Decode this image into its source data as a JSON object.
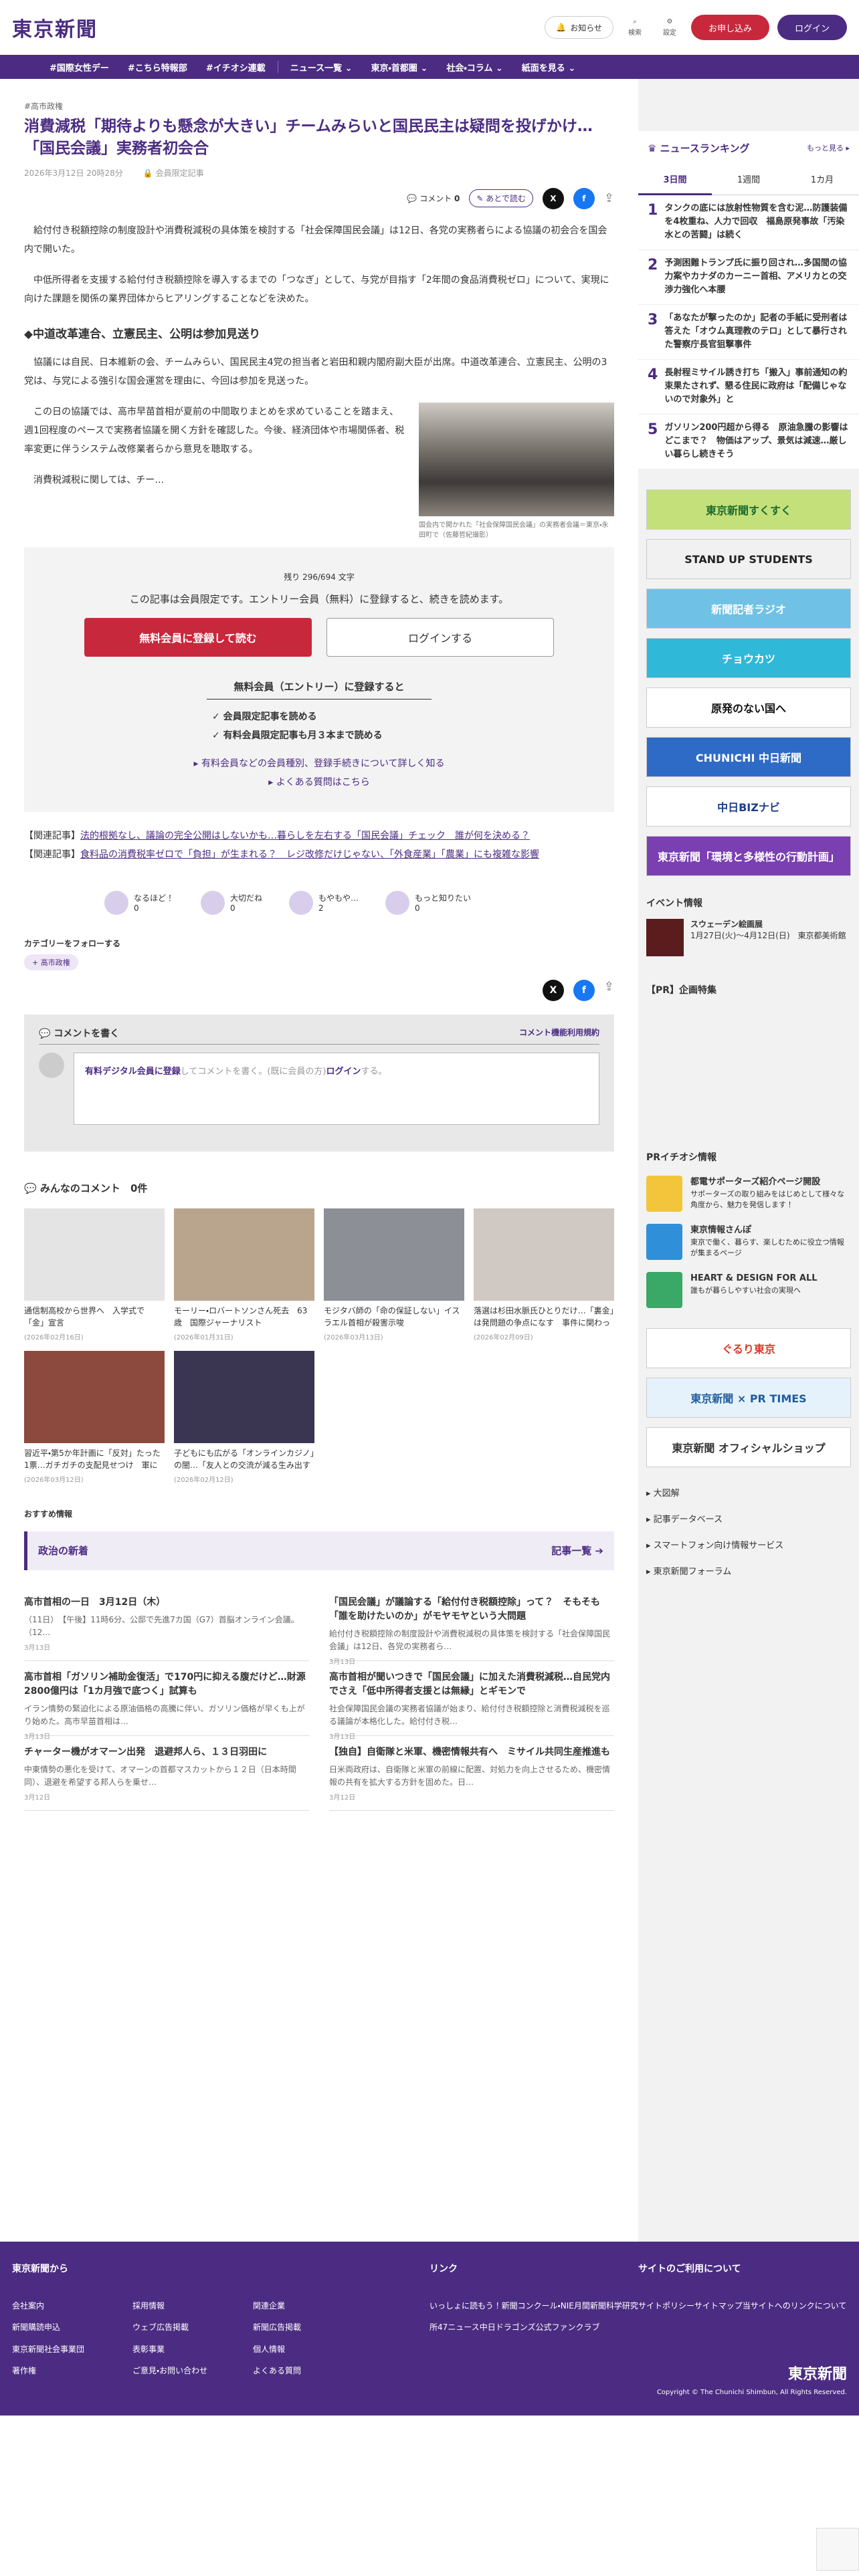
{
  "header": {
    "logo": "東京新聞",
    "notify": "お知らせ",
    "search": "検索",
    "settings": "設定",
    "subscribe": "お申し込み",
    "login": "ログイン"
  },
  "nav": [
    "#国際女性デー",
    "#こちら特報部",
    "#イチオシ連載",
    "ニュース一覧 ⌄",
    "東京・首都圏 ⌄",
    "社会・コラム ⌄",
    "紙面を見る ⌄"
  ],
  "article": {
    "tag": "#高市政権",
    "title": "消費減税「期待よりも懸念が大きい」チームみらいと国民民主は疑問を投げかけ…「国民会議」実務者初会合",
    "date": "2026年3月12日 20時28分",
    "members": "会員限定記事",
    "comments_label": "コメント",
    "comments_count": "0",
    "later": "あとで読む",
    "p1": "給付付き税額控除の制度設計や消費税減税の具体策を検討する「社会保障国民会議」は12日、各党の実務者らによる協議の初会合を国会内で開いた。",
    "p2": "中低所得者を支援する給付付き税額控除を導入するまでの「つなぎ」として、与党が目指す「2年間の食品消費税ゼロ」について、実現に向けた課題を関係の業界団体からヒアリングすることなどを決めた。",
    "h2": "◆中道改革連合、立憲民主、公明は参加見送り",
    "p3": "協議には自民、日本維新の会、チームみらい、国民民主4党の担当者と岩田和親内閣府副大臣が出席。中道改革連合、立憲民主、公明の3党は、与党による強引な国会運営を理由に、今回は参加を見送った。",
    "p4": "この日の協議では、高市早苗首相が夏前の中間取りまとめを求めていることを踏まえ、週1回程度のペースで実務者協議を開く方針を確認した。今後、経済団体や市場関係者、税率変更に伴うシステム改修業者らから意見を聴取する。",
    "p5": "消費税減税に関しては、チー…",
    "caption": "国会内で開かれた「社会保障国民会議」の実務者会議＝東京・永田町で（佐藤哲紀撮影）"
  },
  "paywall": {
    "remaining": "残り 296/694 文字",
    "msg": "この記事は会員限定です。エントリー会員（無料）に登録すると、続きを読めます。",
    "register": "無料会員に登録して読む",
    "login": "ログインする",
    "h3": "無料会員（エントリー）に登録すると",
    "b1": "✓ 会員限定記事を読める",
    "b2": "✓ 有料会員限定記事も月３本まで読める",
    "l1": "▸ 有料会員などの会員種別、登録手続きについて詳しく知る",
    "l2": "▸ よくある質問はこちら"
  },
  "related": [
    {
      "label": "【関連記事】",
      "link": "法的根拠なし、議論の完全公開はしないかも…暮らしを左右する「国民会議」チェック　誰が何を決める？"
    },
    {
      "label": "【関連記事】",
      "link": "食料品の消費税率ゼロで「負担」が生まれる？　レジ改修だけじゃない、「外食産業」「農業」にも複雑な影響"
    }
  ],
  "reactions": [
    {
      "label": "なるほど！",
      "count": "0"
    },
    {
      "label": "大切だね",
      "count": "0"
    },
    {
      "label": "もやもや…",
      "count": "2"
    },
    {
      "label": "もっと知りたい",
      "count": "0"
    }
  ],
  "follow": {
    "title": "カテゴリーをフォローする",
    "tag": "高市政権"
  },
  "comment": {
    "title": "コメントを書く",
    "rules": "コメント機能利用規約",
    "cta_link": "有料デジタル会員に登録",
    "cta_mid": "してコメントを書く。(既に会員の方)",
    "cta_login": "ログイン",
    "cta_end": "する。"
  },
  "everyone": {
    "title": "みんなのコメント",
    "count": "0件"
  },
  "cards": [
    {
      "t": "通信制高校から世界へ　入学式で「金」宣言",
      "d": "(2026年02月16日)",
      "c": "#e4e4e4"
    },
    {
      "t": "モーリー・ロバートソンさん死去　63歳　国際ジャーナリスト",
      "d": "(2026年01月31日)",
      "c": "#b9a58d"
    },
    {
      "t": "モジタバ師の「命の保証しない」イスラエル首相が殺害示唆",
      "d": "(2026年03月13日)",
      "c": "#8d8f96"
    },
    {
      "t": "落選は杉田水脈氏ひとりだけ…「裏金」は発問題の争点になす　事件に関わった公認候補…",
      "d": "(2026年02月09日)",
      "c": "#d0c8c2"
    },
    {
      "t": "習近平・第5か年計画に「反対」たった1票…ガチガチの支配見せつけ　軍にも「絶対服従」「ム…",
      "d": "(2026年03月12日)",
      "c": "#8c4a3e"
    },
    {
      "t": "子どもにも広がる「オンラインカジノ」の闇…「友人との交流が減る生み出す悪循環」専門…",
      "d": "(2026年02月12日)",
      "c": "#3a3550"
    }
  ],
  "osusume": "おすすめ情報",
  "politics": {
    "title": "政治の新着",
    "more": "記事一覧 ➔",
    "items": [
      {
        "t": "高市首相の一日　3月12日（木）",
        "s": "（11日）　【午後】11時6分、公邸で先進7カ国（G7）首脳オンライン会議。（12…",
        "d": "3月13日"
      },
      {
        "t": "「国民会議」が議論する「給付付き税額控除」って？　そもそも「誰を助けたいのか」がモヤモヤという大問題",
        "s": "給付付き税額控除の制度設計や消費税減税の具体策を検討する「社会保障国民会議」は12日、各党の実務者ら…",
        "d": "3月13日"
      },
      {
        "t": "高市首相「ガソリン補助金復活」で170円に抑える腹だけど…財源2800億円は「1カ月強で底つく」試算も",
        "s": "イラン情勢の緊迫化による原油価格の高騰に伴い、ガソリン価格が早くも上がり始めた。高市早苗首相は…",
        "d": "3月13日"
      },
      {
        "t": "高市首相が聞いつきで「国民会議」に加えた消費税減税…自民党内でさえ「低中所得者支援とは無縁」とギモンで",
        "s": "社会保障国民会議の実務者協議が始まり、給付付き税額控除と消費税減税を巡る議論が本格化した。給付付き税…",
        "d": "3月13日"
      },
      {
        "t": "チャーター機がオマーン出発　退避邦人ら、１３日羽田に",
        "s": "中東情勢の悪化を受けて、オマーンの首都マスカットから１２日（日本時間同）、退避を希望する邦人らを乗せ…",
        "d": "3月12日"
      },
      {
        "t": "【独自】自衛隊と米軍、機密情報共有へ　ミサイル共同生産推進も",
        "s": "日米両政府は、自衛隊と米軍の前線に配置、対処力を向上させるため、機密情報の共有を拡大する方針を固めた。日…",
        "d": "3月12日"
      }
    ]
  },
  "ranking": {
    "title": "ニュースランキング",
    "more": "もっと見る ▸",
    "tabs": [
      "3日間",
      "1週間",
      "1カ月"
    ],
    "items": [
      {
        "n": "1",
        "t": "タンクの底には放射性物質を含む泥…防護装備を4枚重ね、人力で回収　福島原発事故「汚染水との苦闘」は続く"
      },
      {
        "n": "2",
        "t": "予測困難トランプ氏に振り回され…多国間の協力案やカナダのカーニー首相、アメリカとの交渉力強化へ本腰"
      },
      {
        "n": "3",
        "t": "「あなたが撃ったのか」記者の手紙に受刑者は答えた「オウム真理教のテロ」として暴行された警察庁長官狙撃事件"
      },
      {
        "n": "4",
        "t": "長射程ミサイル誘き打ち「搬入」事前通知の約束果たされず、懇る住民に政府は「配備じゃないので対象外」と"
      },
      {
        "n": "5",
        "t": "ガソリン200円超から得る　原油急騰の影響はどこまで？　物価はアップ、景気は減速…厳しい暮らし続きそう"
      }
    ]
  },
  "banners": [
    {
      "label": "東京新聞すくすく",
      "bg": "#c4e07a",
      "fg": "#1a6b2f"
    },
    {
      "label": "STAND UP STUDENTS",
      "bg": "#f1f1f1",
      "fg": "#222"
    },
    {
      "label": "新聞記者ラジオ",
      "bg": "#6fc2e6",
      "fg": "#fff"
    },
    {
      "label": "チョウカツ",
      "bg": "#30b8d8",
      "fg": "#fff"
    },
    {
      "label": "原発のない国へ",
      "bg": "#ffffff",
      "fg": "#111"
    },
    {
      "label": "CHUNICHI 中日新聞",
      "bg": "#2e6bc6",
      "fg": "#fff"
    },
    {
      "label": "中日BIZナビ",
      "bg": "#ffffff",
      "fg": "#1d3e8a"
    },
    {
      "label": "東京新聞「環境と多様性の行動計画」",
      "bg": "#7a3fb1",
      "fg": "#fff"
    }
  ],
  "events": {
    "title": "イベント情報",
    "name": "スウェーデン絵画展",
    "desc": "1月27日(火)〜4月12日(日)　東京都美術館"
  },
  "pr_title": "【PR】企画特集",
  "pr_info": {
    "title": "PRイチオシ情報",
    "items": [
      {
        "t": "都電サポーターズ紹介ページ開設",
        "s": "サポーターズの取り組みをはじめとして様々な角度から、魅力を発信します！",
        "c": "#f3c53a"
      },
      {
        "t": "東京情報さんぽ",
        "s": "東京で働く、暮らす、楽しむために役立つ情報が集まるページ",
        "c": "#2f8fd8"
      },
      {
        "t": "HEART & DESIGN FOR ALL",
        "s": "誰もが暮らしやすい社会の実現へ",
        "c": "#3aa866"
      }
    ]
  },
  "banners2": [
    {
      "label": "ぐるり東京",
      "bg": "#ffffff",
      "fg": "#d83a2a"
    },
    {
      "label": "東京新聞 × PR TIMES",
      "bg": "#e6f2fb",
      "fg": "#1f5c9f"
    },
    {
      "label": "東京新聞 オフィシャルショップ",
      "bg": "#ffffff",
      "fg": "#333"
    }
  ],
  "side_links": [
    "▸ 大図解",
    "▸ 記事データベース",
    "▸ スマートフォン向け情報サービス",
    "▸ 東京新聞フォーラム"
  ],
  "footer": {
    "h1": "東京新聞から",
    "h2": "リンク",
    "h3": "サイトのご利用について",
    "c1": [
      "会社案内",
      "採用情報",
      "関連企業",
      "新聞購読申込",
      "ウェブ広告掲載",
      "新聞広告掲載",
      "東京新聞社会事業団",
      "表彰事業",
      "個人情報",
      "著作権",
      "ご意見・お問い合わせ",
      "よくある質問"
    ],
    "c2": [
      "いっしょに読もう！新聞コンクール・NIE月間",
      "新聞科学研究所",
      "47ニュース",
      "中日ドラゴンズ公式ファンクラブ"
    ],
    "c3": [
      "サイトポリシー",
      "サイトマップ",
      "当サイトへのリンクについて"
    ],
    "logo": "東京新聞",
    "copy": "Copyright © The Chunichi Shimbun, All Rights Reserved."
  }
}
